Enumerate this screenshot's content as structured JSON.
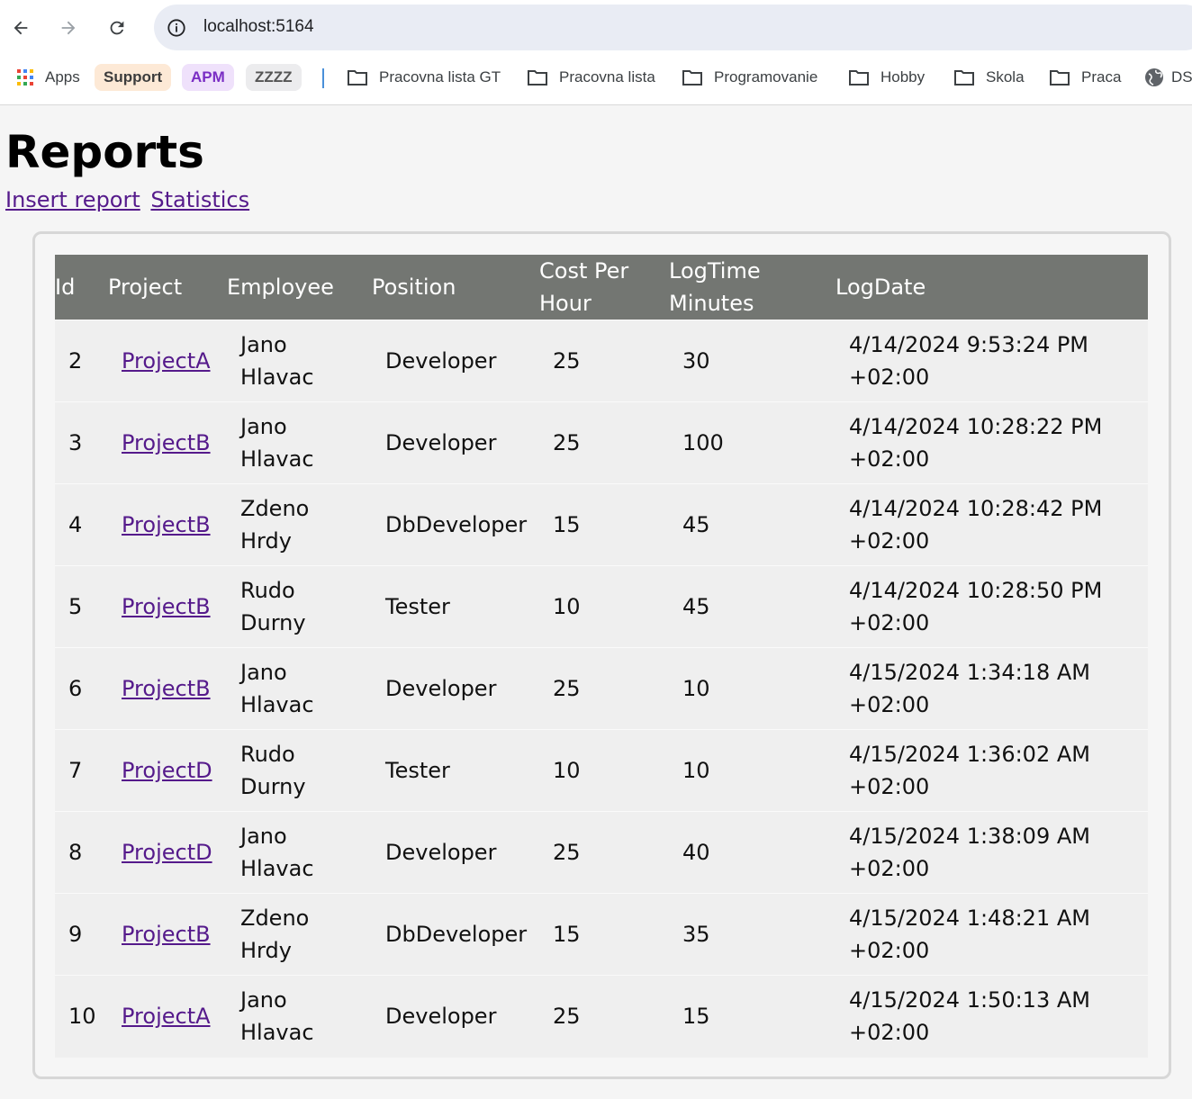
{
  "browser": {
    "url": "localhost:5164",
    "bookmarks": {
      "apps": "Apps",
      "support": "Support",
      "apm": "APM",
      "zzzz": "ZZZZ",
      "folders": [
        "Pracovna lista GT",
        "Pracovna lista",
        "Programovanie",
        "Hobby",
        "Skola",
        "Praca"
      ],
      "ds": "DS"
    }
  },
  "page": {
    "title": "Reports",
    "links": {
      "insert": "Insert report",
      "statistics": "Statistics"
    }
  },
  "table": {
    "headers": {
      "id": "Id",
      "project": "Project",
      "employee": "Employee",
      "position": "Position",
      "cost_1": "Cost Per",
      "cost_2": "Hour",
      "log_1": "LogTime",
      "log_2": "Minutes",
      "date": "LogDate"
    },
    "rows": [
      {
        "id": "2",
        "project": "ProjectA",
        "emp_first": "Jano",
        "emp_last": "Hlavac",
        "position": "Developer",
        "cost": "25",
        "minutes": "30",
        "date_1": "4/14/2024 9:53:24 PM",
        "date_2": "+02:00"
      },
      {
        "id": "3",
        "project": "ProjectB",
        "emp_first": "Jano",
        "emp_last": "Hlavac",
        "position": "Developer",
        "cost": "25",
        "minutes": "100",
        "date_1": "4/14/2024 10:28:22 PM",
        "date_2": "+02:00"
      },
      {
        "id": "4",
        "project": "ProjectB",
        "emp_first": "Zdeno",
        "emp_last": "Hrdy",
        "position": "DbDeveloper",
        "cost": "15",
        "minutes": "45",
        "date_1": "4/14/2024 10:28:42 PM",
        "date_2": "+02:00"
      },
      {
        "id": "5",
        "project": "ProjectB",
        "emp_first": "Rudo",
        "emp_last": "Durny",
        "position": "Tester",
        "cost": "10",
        "minutes": "45",
        "date_1": "4/14/2024 10:28:50 PM",
        "date_2": "+02:00"
      },
      {
        "id": "6",
        "project": "ProjectB",
        "emp_first": "Jano",
        "emp_last": "Hlavac",
        "position": "Developer",
        "cost": "25",
        "minutes": "10",
        "date_1": "4/15/2024 1:34:18 AM",
        "date_2": "+02:00"
      },
      {
        "id": "7",
        "project": "ProjectD",
        "emp_first": "Rudo",
        "emp_last": "Durny",
        "position": "Tester",
        "cost": "10",
        "minutes": "10",
        "date_1": "4/15/2024 1:36:02 AM",
        "date_2": "+02:00"
      },
      {
        "id": "8",
        "project": "ProjectD",
        "emp_first": "Jano",
        "emp_last": "Hlavac",
        "position": "Developer",
        "cost": "25",
        "minutes": "40",
        "date_1": "4/15/2024 1:38:09 AM",
        "date_2": "+02:00"
      },
      {
        "id": "9",
        "project": "ProjectB",
        "emp_first": "Zdeno",
        "emp_last": "Hrdy",
        "position": "DbDeveloper",
        "cost": "15",
        "minutes": "35",
        "date_1": "4/15/2024 1:48:21 AM",
        "date_2": "+02:00"
      },
      {
        "id": "10",
        "project": "ProjectA",
        "emp_first": "Jano",
        "emp_last": "Hlavac",
        "position": "Developer",
        "cost": "25",
        "minutes": "15",
        "date_1": "4/15/2024 1:50:13 AM",
        "date_2": "+02:00"
      }
    ]
  }
}
